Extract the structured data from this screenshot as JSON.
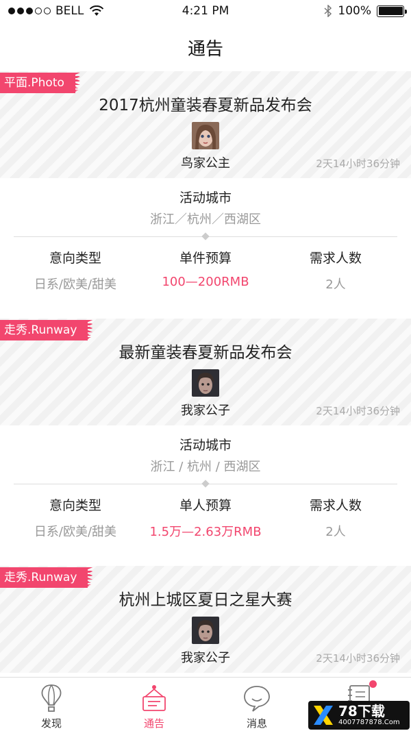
{
  "status_bar": {
    "carrier": "BELL",
    "time": "4:21 PM",
    "battery": "100%",
    "battery_level": 1.0
  },
  "nav": {
    "title": "通告"
  },
  "cards": [
    {
      "tag": "平面.Photo",
      "title": "2017杭州童装春夏新品发布会",
      "user": "鸟家公主",
      "time_ago": "2天14小时36分钟",
      "city_label": "活动城市",
      "city_value": "浙江／杭州／西湖区",
      "col1_label": "意向类型",
      "col1_value": "日系/欧美/甜美",
      "col2_label": "单件预算",
      "col2_value": "100—200RMB",
      "col3_label": "需求人数",
      "col3_value": "2人"
    },
    {
      "tag": "走秀.Runway",
      "title": "最新童装春夏新品发布会",
      "user": "我家公子",
      "time_ago": "2天14小时36分钟",
      "city_label": "活动城市",
      "city_value": "浙江 / 杭州 / 西湖区",
      "col1_label": "意向类型",
      "col1_value": "日系/欧美/甜美",
      "col2_label": "单人预算",
      "col2_value": "1.5万—2.63万RMB",
      "col3_label": "需求人数",
      "col3_value": "2人"
    },
    {
      "tag": "走秀.Runway",
      "title": "杭州上城区夏日之星大赛",
      "user": "我家公子",
      "time_ago": "2天14小时36分钟"
    }
  ],
  "tabs": [
    {
      "label": "发现"
    },
    {
      "label": "通告"
    },
    {
      "label": "消息"
    },
    {
      "label": ""
    }
  ],
  "colors": {
    "accent": "#f2466e",
    "muted": "#999999"
  },
  "watermark": {
    "main": "78下载",
    "sub": "4007787878.Com"
  }
}
